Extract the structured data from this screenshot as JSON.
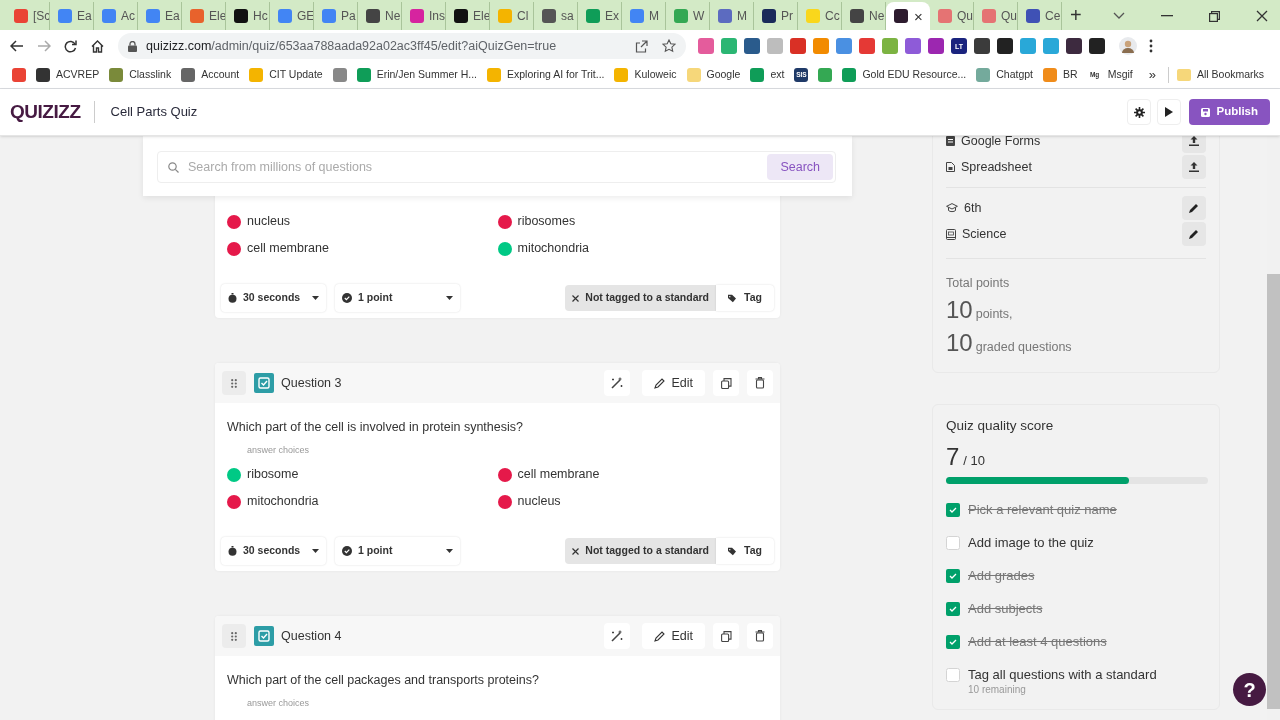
{
  "browser": {
    "tabs": [
      {
        "title": "[Sc",
        "selected": false,
        "color": "#ea4335"
      },
      {
        "title": "Ea",
        "selected": false,
        "color": "#4285f4"
      },
      {
        "title": "Ac",
        "selected": false,
        "color": "#4285f4"
      },
      {
        "title": "Ea",
        "selected": false,
        "color": "#4285f4"
      },
      {
        "title": "Ele",
        "selected": false,
        "color": "#e8622c"
      },
      {
        "title": "Hc",
        "selected": false,
        "color": "#111111"
      },
      {
        "title": "GE",
        "selected": false,
        "color": "#4285f4"
      },
      {
        "title": "Pa",
        "selected": false,
        "color": "#4285f4"
      },
      {
        "title": "Ne",
        "selected": false,
        "color": "#444444"
      },
      {
        "title": "Ins",
        "selected": false,
        "color": "#d6249f"
      },
      {
        "title": "Ele",
        "selected": false,
        "color": "#111111"
      },
      {
        "title": "Cl",
        "selected": false,
        "color": "#f4b400"
      },
      {
        "title": "sa",
        "selected": false,
        "color": "#555555"
      },
      {
        "title": "Ex",
        "selected": false,
        "color": "#0f9d58"
      },
      {
        "title": "M",
        "selected": false,
        "color": "#4285f4"
      },
      {
        "title": "W",
        "selected": false,
        "color": "#34a853"
      },
      {
        "title": "M",
        "selected": false,
        "color": "#5c6bc0"
      },
      {
        "title": "Pr",
        "selected": false,
        "color": "#1a2a5a"
      },
      {
        "title": "Cc",
        "selected": false,
        "color": "#f9d71c"
      },
      {
        "title": "Ne",
        "selected": false,
        "color": "#444444"
      },
      {
        "selected": true,
        "color": "#2d1b2e",
        "close": "×"
      },
      {
        "title": "Qu",
        "selected": false,
        "color": "#e57373"
      },
      {
        "title": "Qu",
        "selected": false,
        "color": "#e57373"
      },
      {
        "title": "Ce",
        "selected": false,
        "color": "#3f51b5"
      }
    ],
    "new_tab": "+",
    "url_host": "quizizz.com",
    "url_path": "/admin/quiz/653aa788aada92a02ac3ff45/edit?aiQuizGen=true",
    "extensions": [
      {
        "color": "#e45c9c"
      },
      {
        "color": "#2bb673"
      },
      {
        "color": "#2a5b8c"
      },
      {
        "color": "#bdbdbd"
      },
      {
        "color": "#d93025"
      },
      {
        "color": "#f28b00"
      },
      {
        "color": "#4a90e2"
      },
      {
        "color": "#e53935"
      },
      {
        "color": "#7cb342"
      },
      {
        "color": "#8e5bd8"
      },
      {
        "color": "#9c27b0"
      },
      {
        "color": "#1a237e",
        "text": "LT"
      },
      {
        "color": "#3b3b3b"
      },
      {
        "color": "#222222"
      },
      {
        "color": "#29a8d8"
      },
      {
        "color": "#29a8d8"
      },
      {
        "color": "#3d2a3f"
      },
      {
        "color": "#222222"
      }
    ],
    "bookmarks": [
      {
        "color": "#ea4335"
      },
      {
        "label": "ACVREP",
        "color": "#333333"
      },
      {
        "label": "Classlink",
        "color": "#7a8a3a"
      },
      {
        "label": "Account",
        "color": "#666666"
      },
      {
        "label": "CIT Update",
        "color": "#f4b400"
      },
      {
        "color": "#888888"
      },
      {
        "label": "Erin/Jen Summer H...",
        "color": "#0f9d58"
      },
      {
        "label": "Exploring AI for Trit...",
        "color": "#f4b400"
      },
      {
        "label": "Kuloweic",
        "color": "#f4b400"
      },
      {
        "label": "Google",
        "color": "#f6d77a"
      },
      {
        "label": "ext",
        "color": "#0f9d58"
      },
      {
        "icon_text": "SIS",
        "color": "#1f3a68"
      },
      {
        "color": "#34a853"
      },
      {
        "label": "Gold EDU Resource...",
        "color": "#0f9d58"
      },
      {
        "label": "Chatgpt",
        "color": "#74aa9c"
      },
      {
        "label": "BR",
        "color": "#f08c1a"
      },
      {
        "label": "Msgif",
        "icon_text": "Mg",
        "color": "#ffffff"
      }
    ],
    "more": "»",
    "all_bookmarks": "All Bookmarks"
  },
  "header": {
    "logo": "QUIZIZZ",
    "title": "Cell Parts Quiz",
    "publish": "Publish"
  },
  "search": {
    "placeholder": "Search from millions of questions",
    "button": "Search"
  },
  "questions": [
    {
      "choices": [
        {
          "text": "nucleus",
          "correct": false
        },
        {
          "text": "ribosomes",
          "correct": false
        },
        {
          "text": "cell membrane",
          "correct": false
        },
        {
          "text": "mitochondria",
          "correct": true
        }
      ],
      "time": "30 seconds",
      "points": "1 point",
      "standard": "Not tagged to a standard",
      "tag": "Tag"
    },
    {
      "title": "Question 3",
      "edit": "Edit",
      "prompt": "Which part of the cell is involved in protein synthesis?",
      "choices_label": "answer choices",
      "choices": [
        {
          "text": "ribosome",
          "correct": true
        },
        {
          "text": "cell membrane",
          "correct": false
        },
        {
          "text": "mitochondria",
          "correct": false
        },
        {
          "text": "nucleus",
          "correct": false
        }
      ],
      "time": "30 seconds",
      "points": "1 point",
      "standard": "Not tagged to a standard",
      "tag": "Tag"
    },
    {
      "title": "Question 4",
      "edit": "Edit",
      "prompt": "Which part of the cell packages and transports proteins?",
      "choices_label": "answer choices"
    }
  ],
  "side": {
    "exports": [
      {
        "label": "Google Forms"
      },
      {
        "label": "Spreadsheet"
      }
    ],
    "meta": [
      {
        "kind": "grade",
        "label": "6th"
      },
      {
        "kind": "subject",
        "label": "Science"
      }
    ],
    "total_label": "Total points",
    "points": "10",
    "points_unit": "points,",
    "graded": "10",
    "graded_unit": "graded questions"
  },
  "quality": {
    "title": "Quiz quality score",
    "score": "7",
    "out_of": "/ 10",
    "level": 0.7,
    "items": [
      {
        "label": "Pick a relevant quiz name",
        "checked": true
      },
      {
        "label": "Add image to the quiz",
        "checked": false
      },
      {
        "label": "Add grades",
        "checked": true
      },
      {
        "label": "Add subjects",
        "checked": true
      },
      {
        "label": "Add at least 4 questions",
        "checked": true
      },
      {
        "label": "Tag all questions with a standard",
        "checked": false,
        "note": "10 remaining"
      }
    ]
  },
  "help": "?"
}
